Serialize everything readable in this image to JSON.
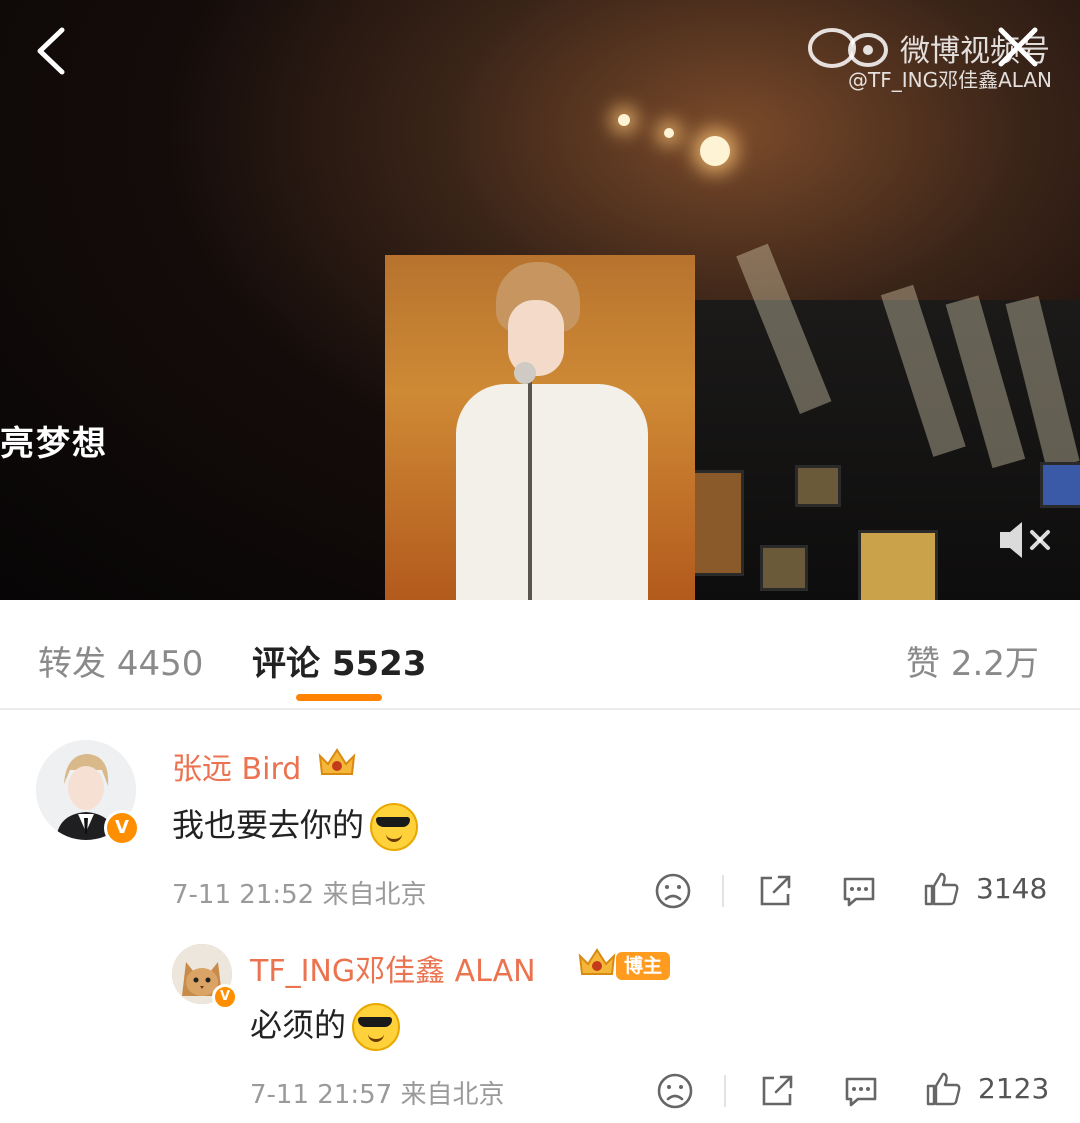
{
  "video": {
    "watermark_title": "微博视频号",
    "watermark_handle": "@TF_ING邓佳鑫ALAN",
    "lyric_text": "亮梦想"
  },
  "tabs": {
    "repost": {
      "label": "转发",
      "count": "4450"
    },
    "comment": {
      "label": "评论",
      "count": "5523"
    },
    "like": {
      "label": "赞",
      "count": "2.2万"
    }
  },
  "comments": [
    {
      "username": "张远 Bird",
      "text": "我也要去你的",
      "time": "7-11 21:52",
      "location": "来自北京",
      "likes": "3148"
    },
    {
      "username": "TF_ING邓佳鑫 ALAN",
      "badge": "博主",
      "text": "必须的",
      "time": "7-11 21:57",
      "location": "来自北京",
      "likes": "2123"
    }
  ],
  "colors": {
    "accent": "#ff8200",
    "username": "#eb7350",
    "vip_badge": "#ff8f00"
  }
}
